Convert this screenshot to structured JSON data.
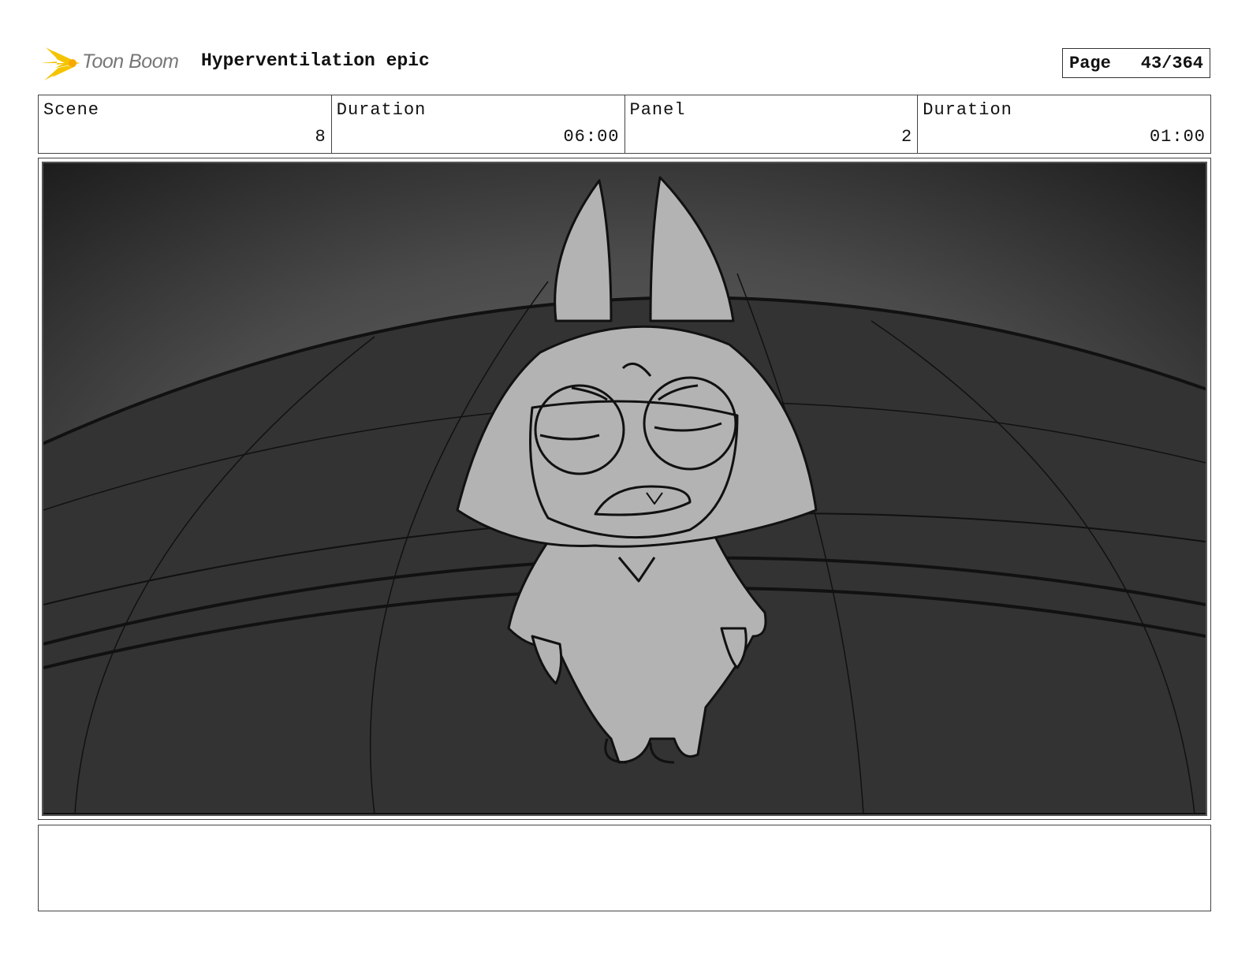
{
  "header": {
    "logo_text": "Toon Boom",
    "title": "Hyperventilation epic",
    "page_label": "Page",
    "page_number": "43/364"
  },
  "info": {
    "scene_label": "Scene",
    "scene_value": "8",
    "scene_duration_label": "Duration",
    "scene_duration_value": "06:00",
    "panel_label": "Panel",
    "panel_value": "2",
    "panel_duration_label": "Duration",
    "panel_duration_value": "01:00"
  },
  "colors": {
    "logo_accent": "#f5c400",
    "sky_top": "#1c1c1c",
    "sky_glow": "#6a6a6a",
    "dome": "#333333",
    "character_fill": "#b3b3b3",
    "line": "#111111"
  },
  "notes": {
    "text": ""
  }
}
